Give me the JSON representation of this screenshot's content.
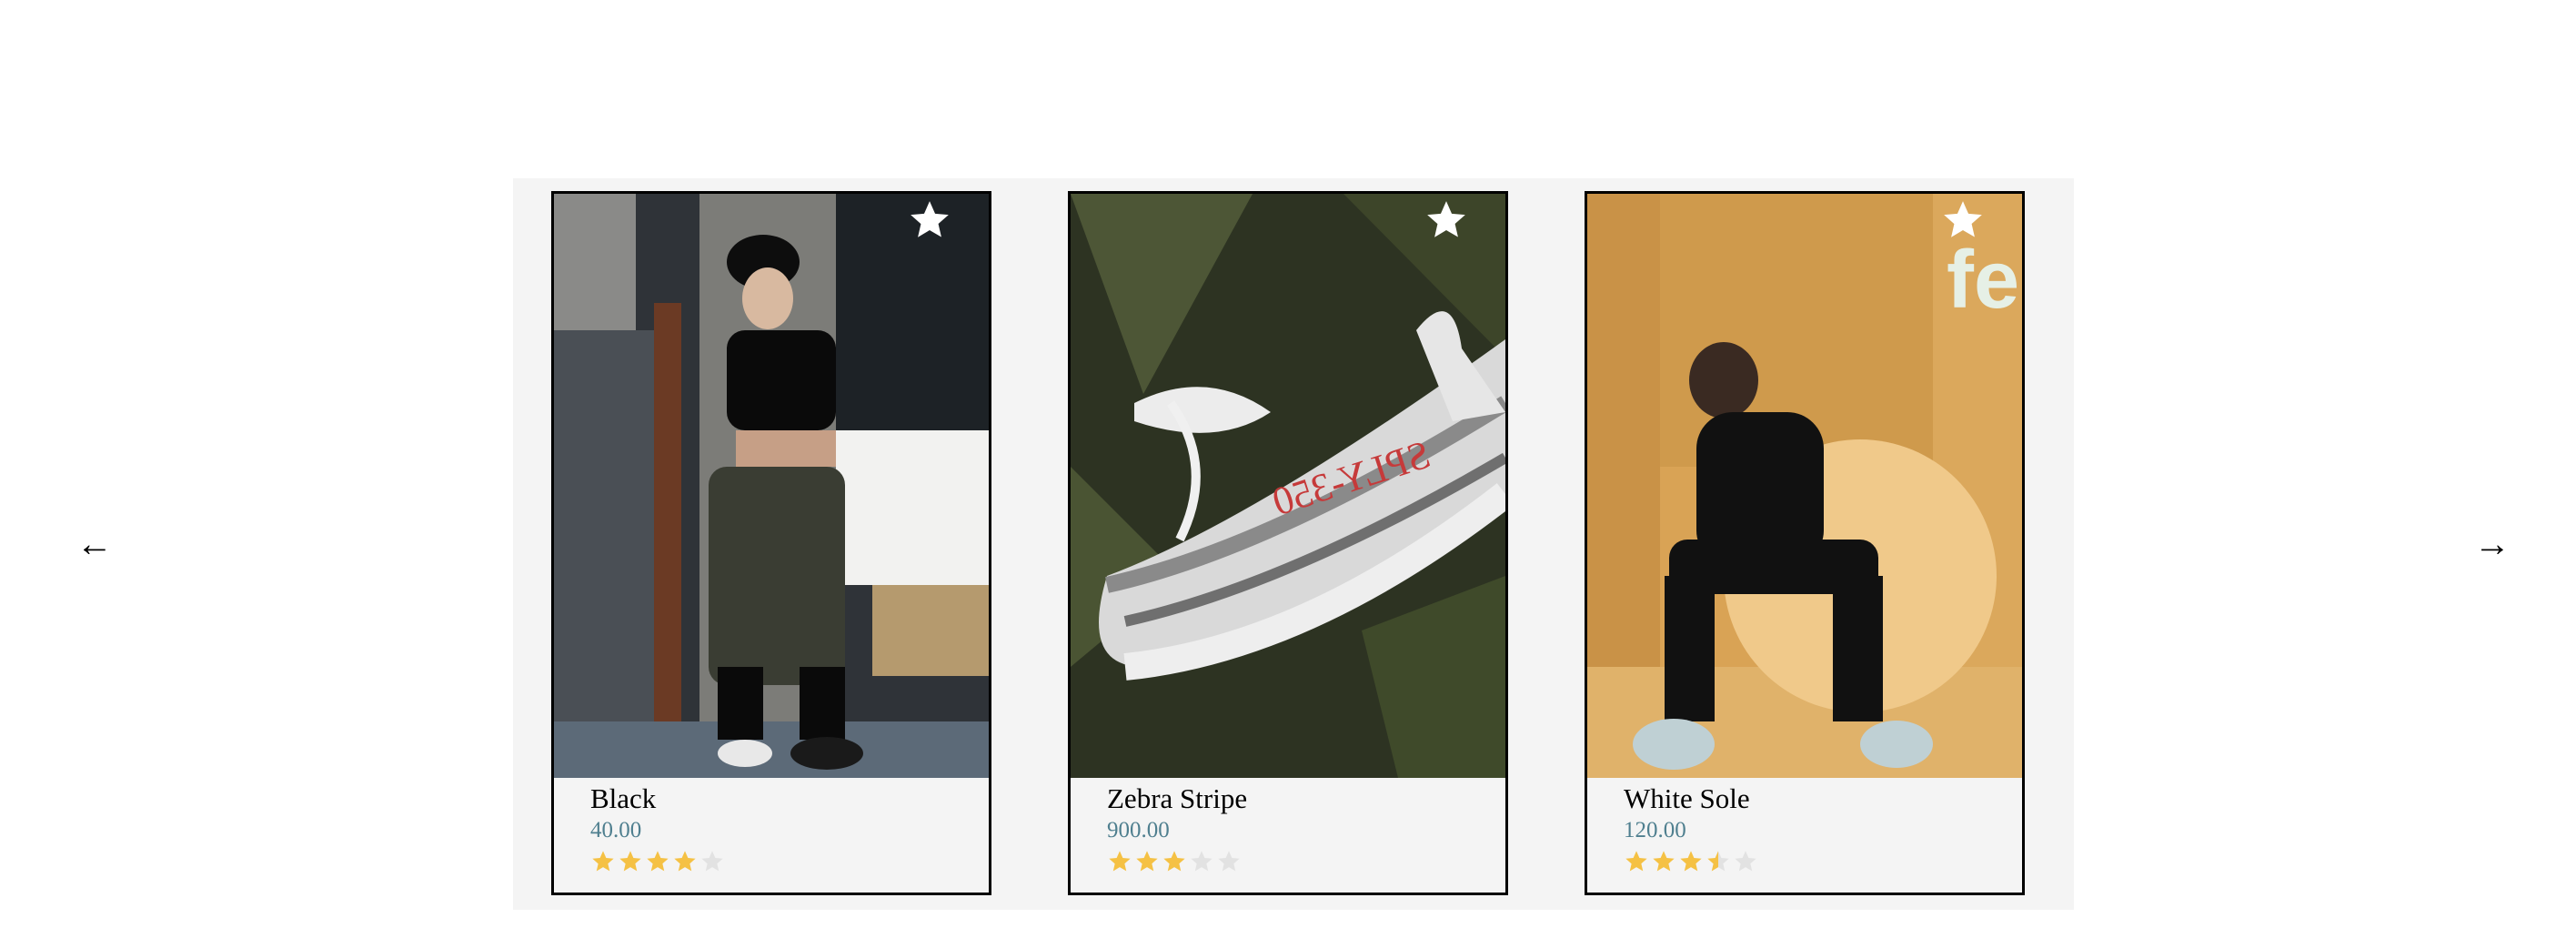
{
  "nav": {
    "prev_symbol": "←",
    "next_symbol": "→"
  },
  "products": [
    {
      "name": "Black",
      "price": "40.00",
      "rating": 4,
      "rating_max": 5
    },
    {
      "name": "Zebra Stripe",
      "price": "900.00",
      "rating": 3,
      "rating_max": 5
    },
    {
      "name": "White Sole",
      "price": "120.00",
      "rating": 3.5,
      "rating_max": 5
    }
  ],
  "colors": {
    "price": "#4f7f8f",
    "star_filled": "#f5c144",
    "star_empty": "#e2e2e2",
    "favorite_icon": "#ffffff",
    "carousel_background": "#f4f4f4"
  },
  "icons": {
    "prev": "arrow-left-icon",
    "next": "arrow-right-icon",
    "favorite": "star-icon",
    "rating": "rating-star-icon"
  }
}
